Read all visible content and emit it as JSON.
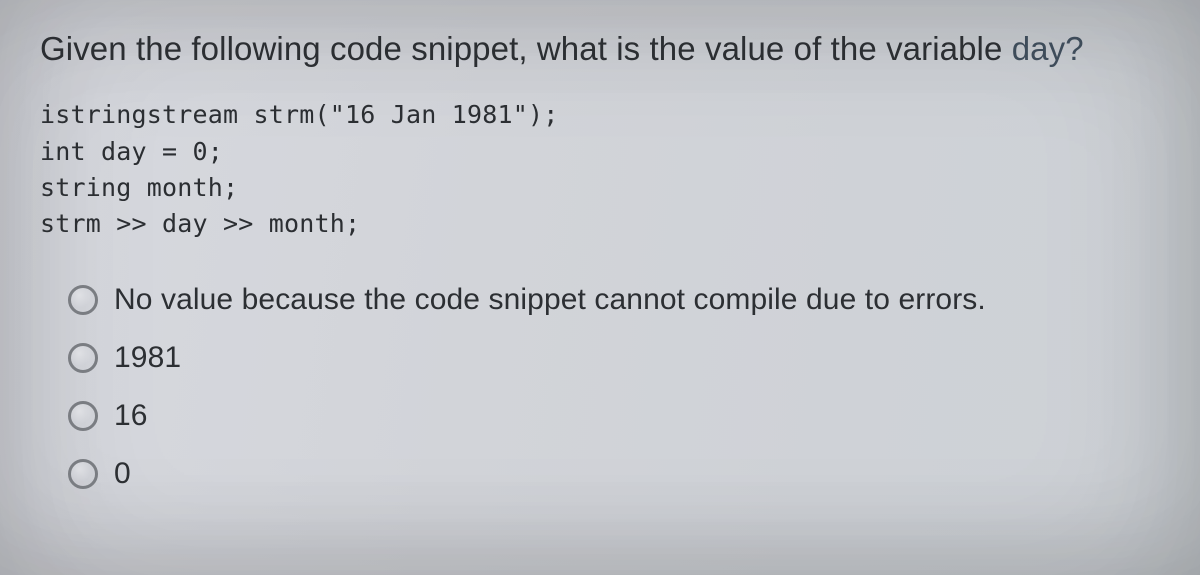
{
  "question_prefix": "Given the following code snippet, what is the value of the variable ",
  "question_tail": "day?",
  "code": "istringstream strm(\"16 Jan 1981\");\nint day = 0;\nstring month;\nstrm >> day >> month;",
  "options": [
    "No value because the code snippet cannot compile due to errors.",
    "1981",
    "16",
    "0"
  ]
}
